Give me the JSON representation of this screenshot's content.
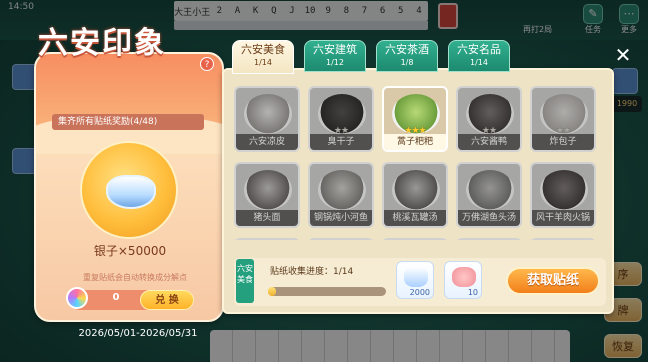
{
  "status": {
    "clock": "14:50"
  },
  "card_tracker": {
    "cards": [
      "大王",
      "小王",
      "2",
      "A",
      "K",
      "Q",
      "J",
      "10",
      "9",
      "8",
      "7",
      "6",
      "5",
      "4"
    ]
  },
  "top_menu": {
    "replay_label": "再打2局",
    "task_label": "任务",
    "more_label": "更多"
  },
  "side": {
    "chip1": "1990",
    "right_btn1": "序",
    "right_btn2": "牌",
    "restore_label": "恢复"
  },
  "event": {
    "title": "六安印象",
    "help": "?",
    "reward_label": "集齐所有贴纸奖励(4/48)",
    "reward_amount": "银子×50000",
    "dup_note": "重复贴纸会自动转换成分解点",
    "exchange_count": "0",
    "exchange_button": "兑 换",
    "date_range": "2026/05/01-2026/05/31"
  },
  "tabs": [
    {
      "name": "六安美食",
      "count": "1/14",
      "active": true
    },
    {
      "name": "六安建筑",
      "count": "1/12",
      "active": false
    },
    {
      "name": "六安茶酒",
      "count": "1/8",
      "active": false
    },
    {
      "name": "六安名品",
      "count": "1/14",
      "active": false
    }
  ],
  "close_icon": "close-icon",
  "stickers": [
    {
      "name": "六安凉皮",
      "owned": false,
      "stars": "",
      "c1": "#f2d9a2",
      "c2": "#c98a4a"
    },
    {
      "name": "臭干子",
      "owned": false,
      "stars": "★★",
      "c1": "#6b4a2f",
      "c2": "#3f2a18"
    },
    {
      "name": "蒿子粑粑",
      "owned": true,
      "stars": "★★★",
      "c1": "#b8d977",
      "c2": "#6c9e3c"
    },
    {
      "name": "六安酱鸭",
      "owned": false,
      "stars": "★★",
      "c1": "#c0623a",
      "c2": "#7d2f17"
    },
    {
      "name": "炸包子",
      "owned": false,
      "stars": "★★",
      "c1": "#f5cf8a",
      "c2": "#d89b4c"
    },
    {
      "name": "猪头面",
      "owned": false,
      "stars": "",
      "c1": "#e3b77e",
      "c2": "#a3552f"
    },
    {
      "name": "钢锅炖小河鱼",
      "owned": false,
      "stars": "",
      "c1": "#e6c56a",
      "c2": "#a77927"
    },
    {
      "name": "桃溪瓦罐汤",
      "owned": false,
      "stars": "",
      "c1": "#d8b58b",
      "c2": "#8d5a2f"
    },
    {
      "name": "万佛湖鱼头汤",
      "owned": false,
      "stars": "",
      "c1": "#c7b28a",
      "c2": "#6d7a4a"
    },
    {
      "name": "风干羊肉火锅",
      "owned": false,
      "stars": "",
      "c1": "#d75a3b",
      "c2": "#8c2a17"
    },
    {
      "name": "",
      "owned": false,
      "stars": "",
      "c1": "#d9c7a3",
      "c2": "#9b7b55"
    },
    {
      "name": "",
      "owned": false,
      "stars": "",
      "c1": "#d9c7a3",
      "c2": "#9b7b55"
    },
    {
      "name": "",
      "owned": false,
      "stars": "",
      "c1": "#d9c7a3",
      "c2": "#9b7b55"
    },
    {
      "name": "",
      "owned": false,
      "stars": "",
      "c1": "#d9c7a3",
      "c2": "#9b7b55"
    },
    {
      "name": "",
      "owned": false,
      "stars": "",
      "c1": "#d9c7a3",
      "c2": "#9b7b55"
    }
  ],
  "bottom": {
    "category_badge": "六安美食",
    "progress_label": "贴纸收集进度：1/14",
    "progress_fraction": 0.0714,
    "bonus1_value": "2000",
    "bonus2_value": "10",
    "get_button": "获取贴纸"
  }
}
